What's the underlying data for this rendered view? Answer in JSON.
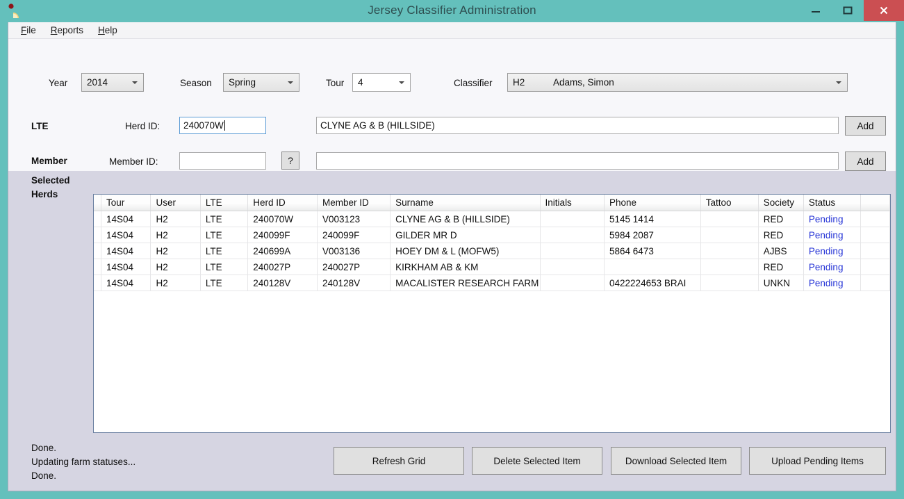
{
  "window": {
    "title": "Jersey Classifier Administration",
    "app_icon": "jersey-app-icon",
    "minimize_label": "—",
    "maximize_label": "□",
    "close_label": "✕",
    "frame_color": "#64c0bc",
    "close_color": "#cb4f52",
    "client_bg": "#d6d5e2"
  },
  "menu": {
    "items": [
      {
        "label": "File",
        "accesskey": "F"
      },
      {
        "label": "Reports",
        "accesskey": "R"
      },
      {
        "label": "Help",
        "accesskey": "H"
      }
    ]
  },
  "filters": {
    "year_label": "Year",
    "year_value": "2014",
    "season_label": "Season",
    "season_value": "Spring",
    "tour_label": "Tour",
    "tour_value": "4",
    "classifier_label": "Classifier",
    "classifier_code": "H2",
    "classifier_name": "Adams, Simon"
  },
  "lte_row": {
    "section_label": "LTE",
    "field_label": "Herd ID:",
    "herd_id_value": "240070W",
    "herd_id_placeholder": "",
    "herd_name_value": "CLYNE AG & B (HILLSIDE)",
    "add_label": "Add"
  },
  "member_row": {
    "section_label": "Member",
    "field_label": "Member ID:",
    "member_id_value": "",
    "member_id_placeholder": "",
    "lookup_label": "?",
    "member_name_value": "",
    "add_label": "Add"
  },
  "grid": {
    "section_label_line1": "Selected",
    "section_label_line2": "Herds",
    "columns": [
      "Tour",
      "User",
      "LTE",
      "Herd ID",
      "Member ID",
      "Surname",
      "Initials",
      "Phone",
      "Tattoo",
      "Society",
      "Status"
    ],
    "rows": [
      {
        "tour": "14S04",
        "user": "H2",
        "lte": "LTE",
        "herd_id": "240070W",
        "member_id": "V003123",
        "surname": "CLYNE AG & B (HILLSIDE)",
        "initials": "",
        "phone": "5145 1414",
        "tattoo": "",
        "society": "RED",
        "status": "Pending"
      },
      {
        "tour": "14S04",
        "user": "H2",
        "lte": "LTE",
        "herd_id": "240099F",
        "member_id": "240099F",
        "surname": "GILDER MR D",
        "initials": "",
        "phone": "5984 2087",
        "tattoo": "",
        "society": "RED",
        "status": "Pending"
      },
      {
        "tour": "14S04",
        "user": "H2",
        "lte": "LTE",
        "herd_id": "240699A",
        "member_id": "V003136",
        "surname": "HOEY DM & L (MOFW5)",
        "initials": "",
        "phone": "5864 6473",
        "tattoo": "",
        "society": "AJBS",
        "status": "Pending"
      },
      {
        "tour": "14S04",
        "user": "H2",
        "lte": "LTE",
        "herd_id": "240027P",
        "member_id": "240027P",
        "surname": "KIRKHAM AB & KM",
        "initials": "",
        "phone": "",
        "tattoo": "",
        "society": "RED",
        "status": "Pending"
      },
      {
        "tour": "14S04",
        "user": "H2",
        "lte": "LTE",
        "herd_id": "240128V",
        "member_id": "240128V",
        "surname": "MACALISTER RESEARCH FARM",
        "initials": "",
        "phone": "0422224653 BRAI",
        "tattoo": "",
        "society": "UNKN",
        "status": "Pending"
      }
    ],
    "status_link_color": "#2432d6"
  },
  "status_log": {
    "lines": [
      "Done.",
      "Updating farm statuses...",
      "Done."
    ]
  },
  "actions": {
    "refresh_label": "Refresh Grid",
    "delete_label": "Delete Selected Item",
    "download_label": "Download Selected Item",
    "upload_label": "Upload Pending Items"
  }
}
